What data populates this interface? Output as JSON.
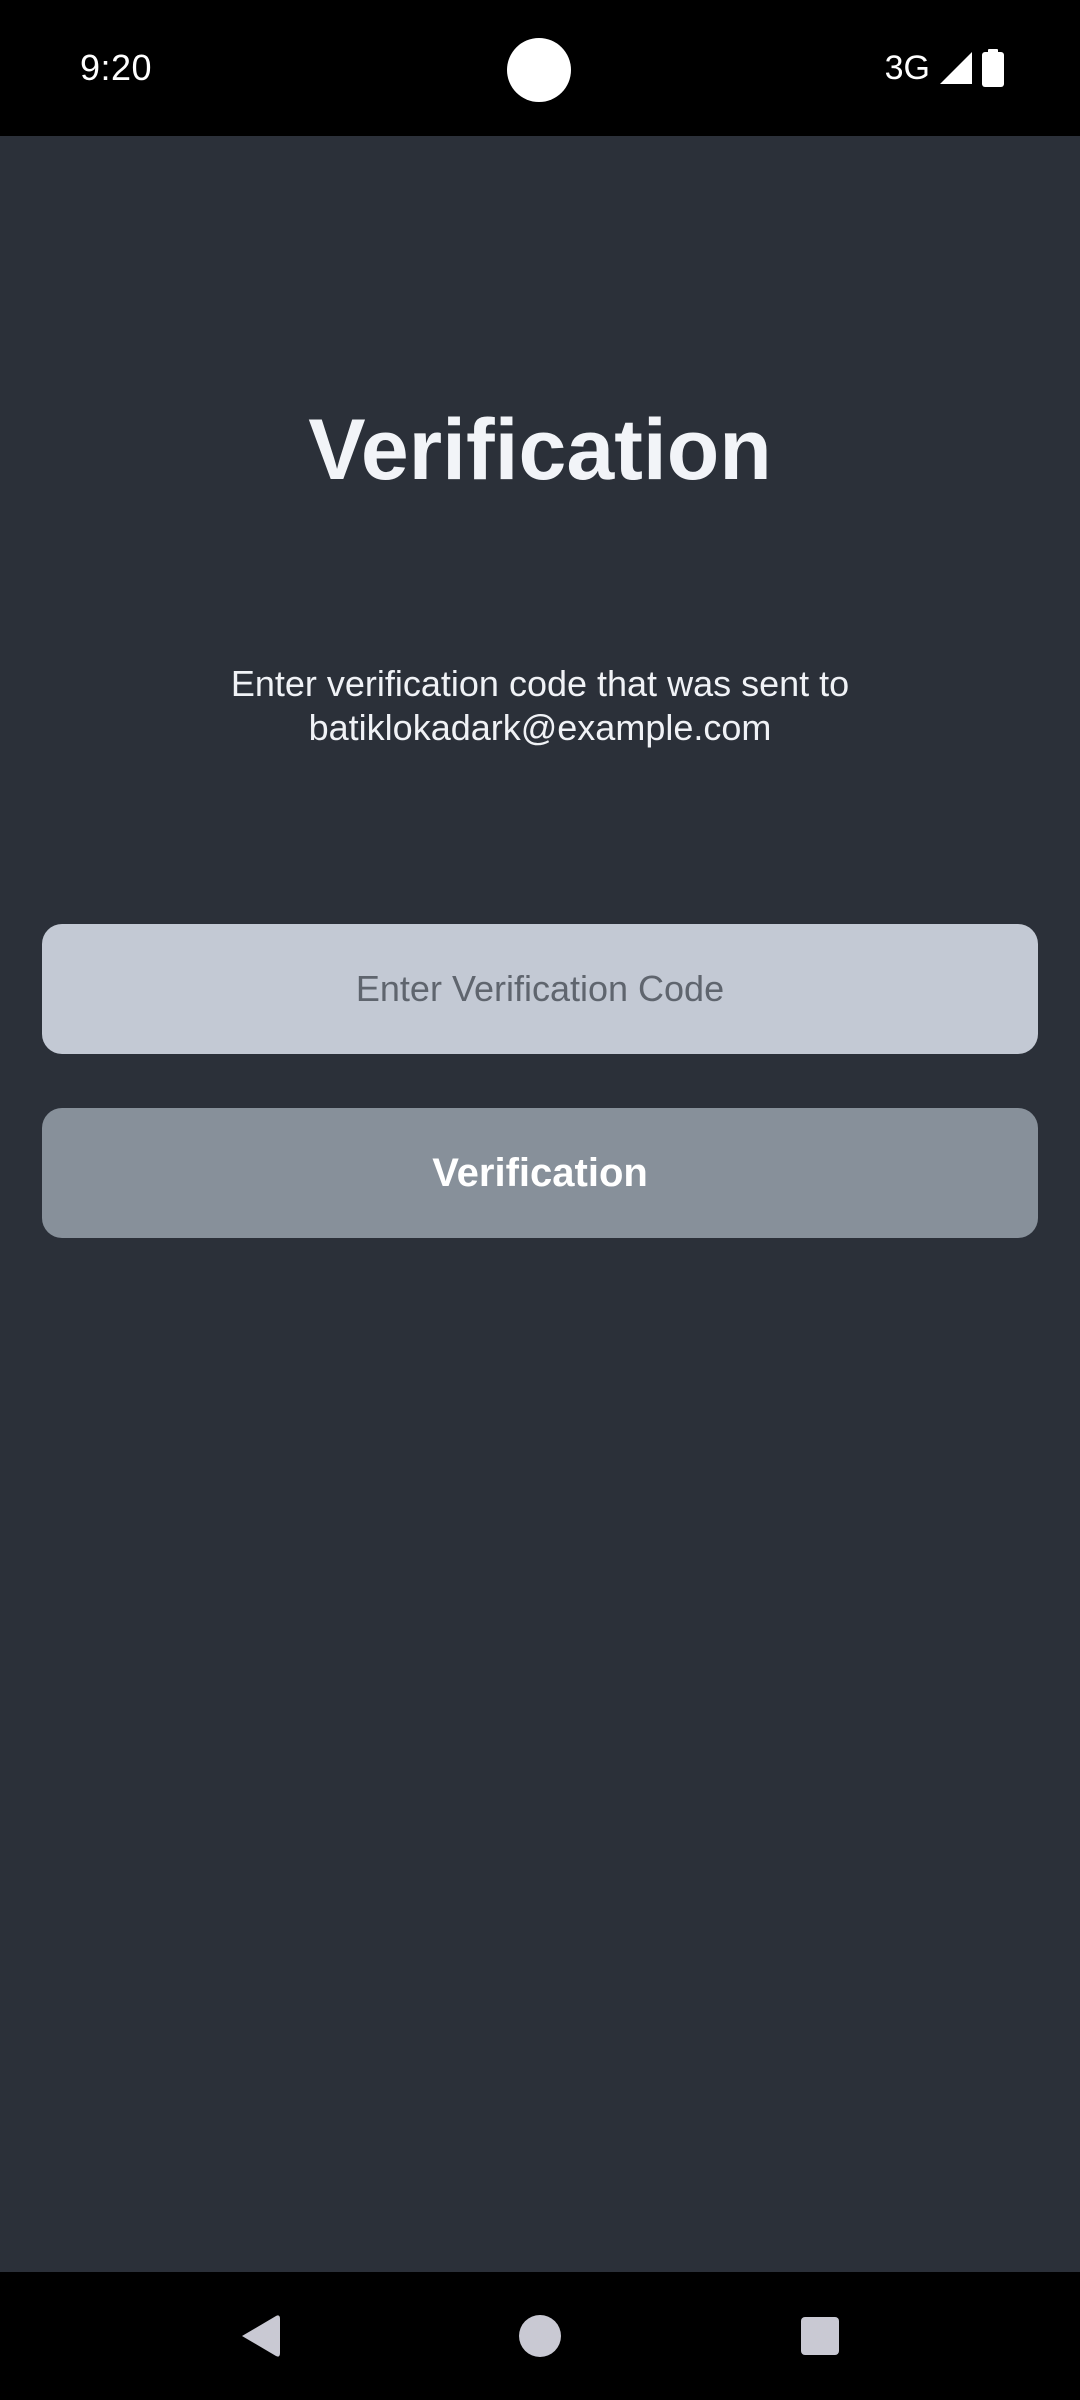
{
  "status_bar": {
    "time": "9:20",
    "network": "3G",
    "icons": [
      "signal-icon",
      "battery-icon"
    ]
  },
  "verification": {
    "title": "Verification",
    "subtitle": "Enter verification code that was sent to batiklokadark@example.com",
    "code_input": {
      "value": "",
      "placeholder": "Enter Verification Code"
    },
    "submit_label": "Verification"
  },
  "navigation_bar": {
    "icons": [
      "back-icon",
      "home-icon",
      "recents-icon"
    ]
  },
  "colors": {
    "background": "#2b3039",
    "input_background": "#c3c9d4",
    "button_background": "#87909a",
    "title_text": "#f2f4f8"
  }
}
